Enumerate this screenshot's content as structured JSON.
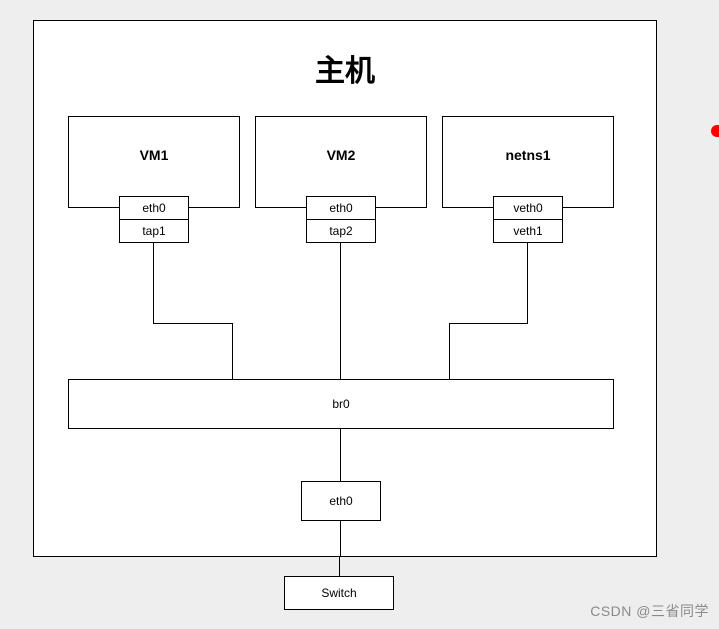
{
  "host": {
    "title": "主机"
  },
  "vm1": {
    "label": "VM1",
    "iface_inner": "eth0",
    "iface_outer": "tap1"
  },
  "vm2": {
    "label": "VM2",
    "iface_inner": "eth0",
    "iface_outer": "tap2"
  },
  "netns1": {
    "label": "netns1",
    "iface_inner": "veth0",
    "iface_outer": "veth1"
  },
  "bridge": {
    "label": "br0"
  },
  "host_iface": {
    "label": "eth0"
  },
  "switch": {
    "label": "Switch"
  },
  "watermark": "CSDN @三省同学"
}
